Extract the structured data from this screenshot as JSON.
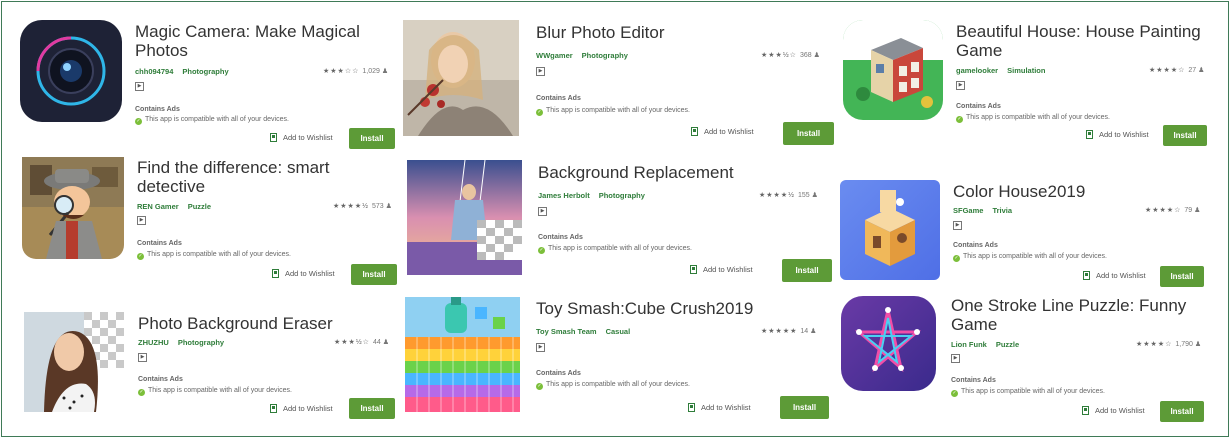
{
  "common": {
    "contains_ads": "Contains Ads",
    "compat_text": "This app is compatible with all of your devices.",
    "wishlist_label": "Add to Wishlist",
    "install_label": "Install"
  },
  "apps": [
    {
      "title1": "Magic Camera: Make Magical",
      "title2": "Photos",
      "developer": "chh094794",
      "category": "Photography",
      "stars": "★★★☆☆",
      "rating_count": "1,029"
    },
    {
      "title1": "Blur Photo Editor",
      "title2": "",
      "developer": "WWgamer",
      "category": "Photography",
      "stars": "★★★½☆",
      "rating_count": "368"
    },
    {
      "title1": "Beautiful House: House Painting",
      "title2": "Game",
      "developer": "gamelooker",
      "category": "Simulation",
      "stars": "★★★★☆",
      "rating_count": "27"
    },
    {
      "title1": "Find the difference: smart",
      "title2": "detective",
      "developer": "REN Gamer",
      "category": "Puzzle",
      "stars": "★★★★½",
      "rating_count": "573"
    },
    {
      "title1": "Background Replacement",
      "title2": "",
      "developer": "James Herbolt",
      "category": "Photography",
      "stars": "★★★★½",
      "rating_count": "155"
    },
    {
      "title1": "Color House2019",
      "title2": "",
      "developer": "SFGame",
      "category": "Trivia",
      "stars": "★★★★☆",
      "rating_count": "79"
    },
    {
      "title1": "Photo Background Eraser",
      "title2": "",
      "developer": "ZHUZHU",
      "category": "Photography",
      "stars": "★★★½☆",
      "rating_count": "44"
    },
    {
      "title1": "Toy Smash:Cube Crush2019",
      "title2": "",
      "developer": "Toy Smash Team",
      "category": "Casual",
      "stars": "★★★★★",
      "rating_count": "14"
    },
    {
      "title1": "One Stroke Line Puzzle: Funny",
      "title2": "Game",
      "developer": "Lion Funk",
      "category": "Puzzle",
      "stars": "★★★★☆",
      "rating_count": "1,790"
    }
  ]
}
